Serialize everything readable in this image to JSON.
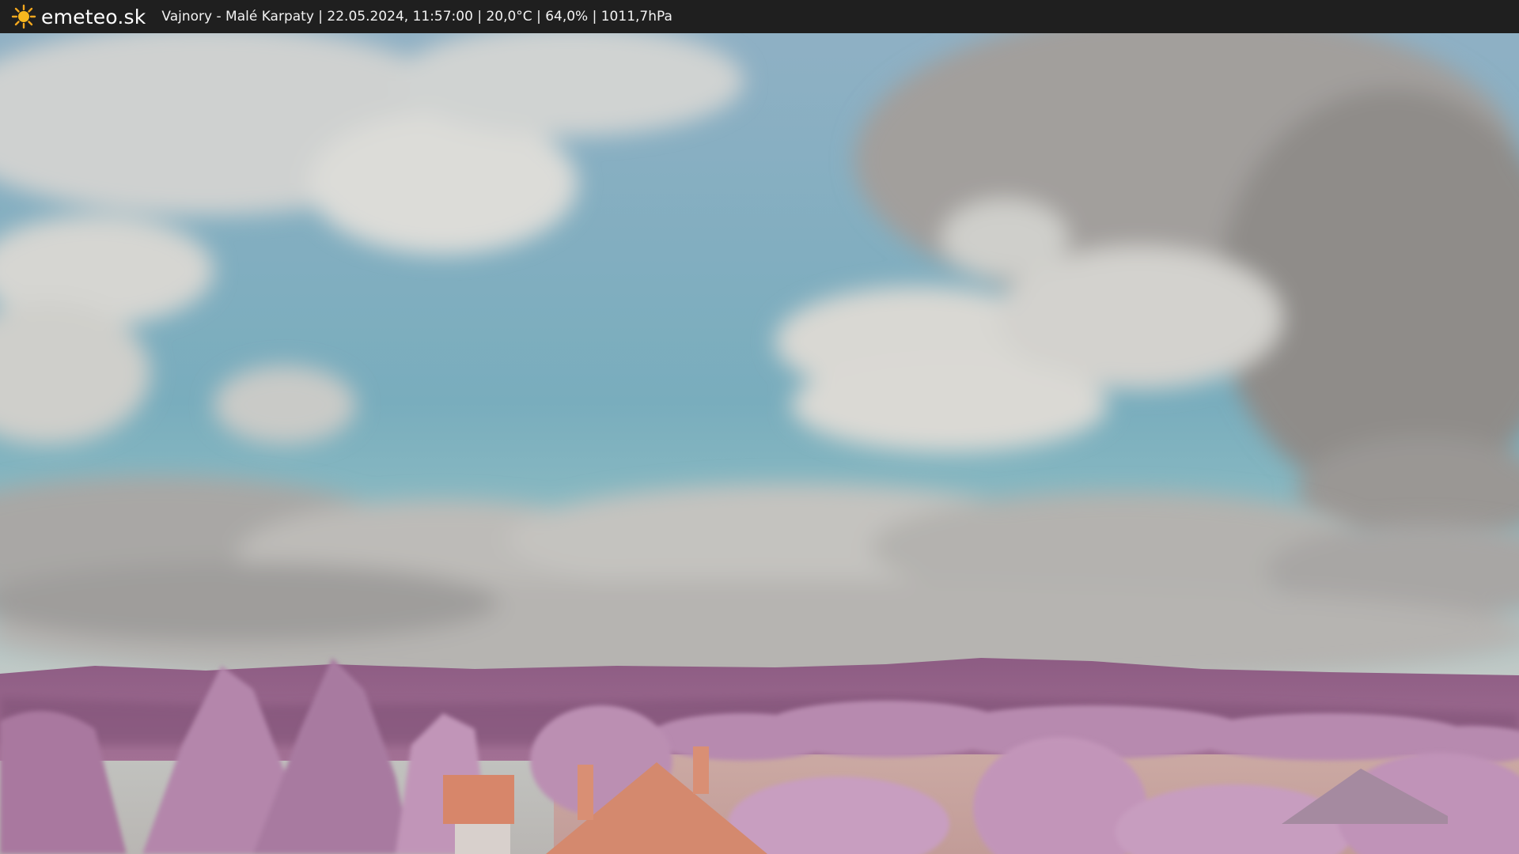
{
  "header": {
    "site_name": "emeteo.sk",
    "logo_icon": "sun-icon",
    "caption": "Vajnory - Malé Karpaty | 22.05.2024, 11:57:00 | 20,0°C | 64,0% | 1011,7hPa"
  },
  "image": {
    "icon": "webcam-photo",
    "colors": {
      "sky": "#6fa7b8",
      "clouds": "#d8d6d2",
      "storm_clouds": "#8e8b88",
      "hills": "#8a5a80",
      "foliage": "#b98ab0",
      "field": "#c9a8a4",
      "roof": "#d0866a"
    }
  }
}
